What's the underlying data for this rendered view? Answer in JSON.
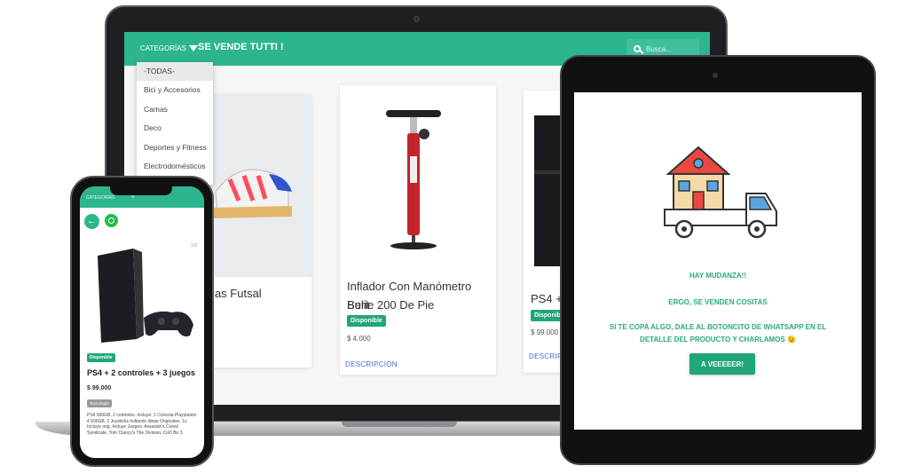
{
  "laptop": {
    "nav": {
      "categories_label": "CATEGORÍAS",
      "brand": "SE VENDE TUTTI !",
      "search_placeholder": "Busca..."
    },
    "dropdown": {
      "items": [
        "-TODAS-",
        "Bici y Accesorios",
        "Camas",
        "Deco",
        "Deportes y Fitness",
        "Electrodomésticos"
      ],
      "selected": "-TODAS-"
    },
    "products": [
      {
        "title": "...idas Futsal"
      },
      {
        "title_line1": "Inflador Con Manómetro Bulit",
        "title_line2": "Serie 200 De Pie",
        "badge": "Disponible",
        "price": "$ 4.000",
        "link": "DESCRIPCIÓN"
      },
      {
        "title": "PS4 +",
        "badge": "Disponible",
        "price": "$ 99.000",
        "link": "DESCRIPC"
      }
    ]
  },
  "phone": {
    "nav": {
      "categories_label": "CATEGORÍAS"
    },
    "product": {
      "badge": "Disponible",
      "title": "PS4 + 2 controles + 3 juegos",
      "price": "$ 99.000",
      "tag": "Tecnología",
      "description": "PS4 500GB, 2 controles. Incluye: 1 Consola Playstation 4 500GB. 2 Joysticks hollands Ideas Originales. 1x Incluye orig. Incluye Juegos: Assassin's Creed Syndicate, Tom Clancy's The Division, CoD Bo 3"
    }
  },
  "tablet": {
    "line1": "HAY MUDANZA!!",
    "line2": "ERGO, SE VENDEN COSITAS",
    "line3": "SI TE COPA ALGO, DALE AL BOTONCITO DE WHATSAPP EN EL",
    "line4": "DETALLE DEL PRODUCTO Y CHARLAMOS 😉",
    "button": "A VEEEEER!"
  },
  "colors": {
    "accent": "#2db58d",
    "badge": "#21a57c",
    "link": "#3d6fd1"
  }
}
